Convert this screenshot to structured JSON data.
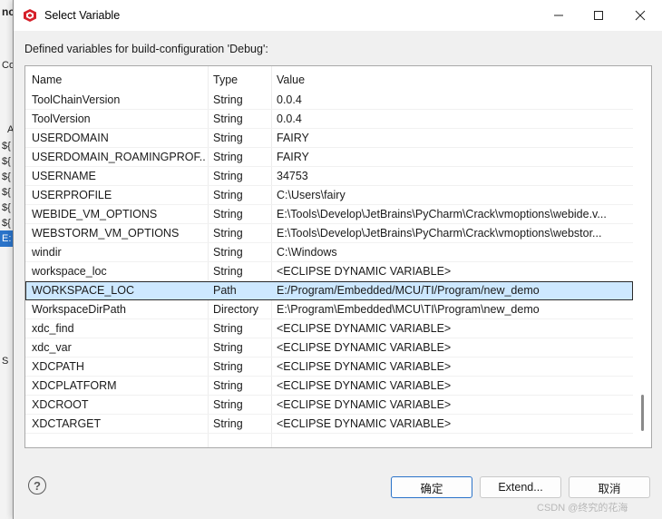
{
  "background_app": {
    "fragments": [
      "nc",
      "Co",
      "A",
      "${",
      "${",
      "${",
      "${",
      "${",
      "${",
      "E:",
      "S"
    ]
  },
  "dialog": {
    "title": "Select Variable",
    "description": "Defined variables for build-configuration 'Debug':",
    "columns": [
      "Name",
      "Type",
      "Value"
    ],
    "rows": [
      {
        "name": "ToolChainVersion",
        "type": "String",
        "value": "0.0.4"
      },
      {
        "name": "ToolVersion",
        "type": "String",
        "value": "0.0.4"
      },
      {
        "name": "USERDOMAIN",
        "type": "String",
        "value": "FAIRY"
      },
      {
        "name": "USERDOMAIN_ROAMINGPROF...",
        "type": "String",
        "value": "FAIRY"
      },
      {
        "name": "USERNAME",
        "type": "String",
        "value": "34753"
      },
      {
        "name": "USERPROFILE",
        "type": "String",
        "value": "C:\\Users\\fairy"
      },
      {
        "name": "WEBIDE_VM_OPTIONS",
        "type": "String",
        "value": "E:\\Tools\\Develop\\JetBrains\\PyCharm\\Crack\\vmoptions\\webide.v..."
      },
      {
        "name": "WEBSTORM_VM_OPTIONS",
        "type": "String",
        "value": "E:\\Tools\\Develop\\JetBrains\\PyCharm\\Crack\\vmoptions\\webstor..."
      },
      {
        "name": "windir",
        "type": "String",
        "value": "C:\\Windows"
      },
      {
        "name": "workspace_loc",
        "type": "String",
        "value": "<ECLIPSE DYNAMIC VARIABLE>"
      },
      {
        "name": "WORKSPACE_LOC",
        "type": "Path",
        "value": "E:/Program/Embedded/MCU/TI/Program/new_demo"
      },
      {
        "name": "WorkspaceDirPath",
        "type": "Directory",
        "value": "E:\\Program\\Embedded\\MCU\\TI\\Program\\new_demo"
      },
      {
        "name": "xdc_find",
        "type": "String",
        "value": "<ECLIPSE DYNAMIC VARIABLE>"
      },
      {
        "name": "xdc_var",
        "type": "String",
        "value": "<ECLIPSE DYNAMIC VARIABLE>"
      },
      {
        "name": "XDCPATH",
        "type": "String",
        "value": "<ECLIPSE DYNAMIC VARIABLE>"
      },
      {
        "name": "XDCPLATFORM",
        "type": "String",
        "value": "<ECLIPSE DYNAMIC VARIABLE>"
      },
      {
        "name": "XDCROOT",
        "type": "String",
        "value": "<ECLIPSE DYNAMIC VARIABLE>"
      },
      {
        "name": "XDCTARGET",
        "type": "String",
        "value": "<ECLIPSE DYNAMIC VARIABLE>"
      }
    ],
    "selected_row_index": 10,
    "buttons": {
      "help": "?",
      "ok": "确定",
      "extend": "Extend...",
      "cancel": "取消"
    }
  },
  "watermark": "CSDN @终究的花海",
  "icons": {
    "app": "eclipse-cube-icon",
    "minimize": "minimize-icon",
    "maximize": "maximize-icon",
    "close": "close-icon",
    "help": "help-icon"
  },
  "colors": {
    "app_icon": "#d6202a",
    "selection": "#cde8ff",
    "focus_button_border": "#2a73c9"
  }
}
